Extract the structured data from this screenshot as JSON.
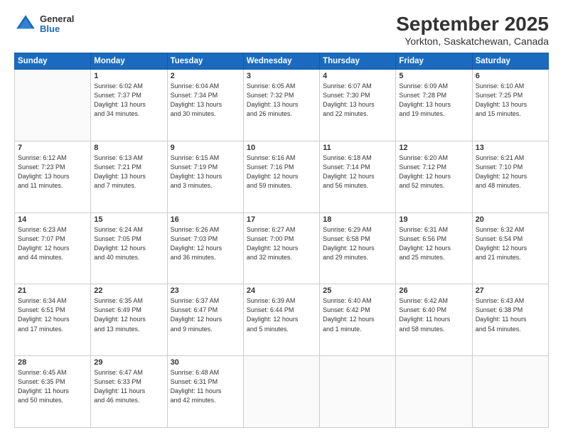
{
  "header": {
    "logo": {
      "general": "General",
      "blue": "Blue"
    },
    "title": "September 2025",
    "subtitle": "Yorkton, Saskatchewan, Canada"
  },
  "calendar": {
    "days_of_week": [
      "Sunday",
      "Monday",
      "Tuesday",
      "Wednesday",
      "Thursday",
      "Friday",
      "Saturday"
    ],
    "weeks": [
      [
        {
          "day": "",
          "info": ""
        },
        {
          "day": "1",
          "info": "Sunrise: 6:02 AM\nSunset: 7:37 PM\nDaylight: 13 hours\nand 34 minutes."
        },
        {
          "day": "2",
          "info": "Sunrise: 6:04 AM\nSunset: 7:34 PM\nDaylight: 13 hours\nand 30 minutes."
        },
        {
          "day": "3",
          "info": "Sunrise: 6:05 AM\nSunset: 7:32 PM\nDaylight: 13 hours\nand 26 minutes."
        },
        {
          "day": "4",
          "info": "Sunrise: 6:07 AM\nSunset: 7:30 PM\nDaylight: 13 hours\nand 22 minutes."
        },
        {
          "day": "5",
          "info": "Sunrise: 6:09 AM\nSunset: 7:28 PM\nDaylight: 13 hours\nand 19 minutes."
        },
        {
          "day": "6",
          "info": "Sunrise: 6:10 AM\nSunset: 7:25 PM\nDaylight: 13 hours\nand 15 minutes."
        }
      ],
      [
        {
          "day": "7",
          "info": "Sunrise: 6:12 AM\nSunset: 7:23 PM\nDaylight: 13 hours\nand 11 minutes."
        },
        {
          "day": "8",
          "info": "Sunrise: 6:13 AM\nSunset: 7:21 PM\nDaylight: 13 hours\nand 7 minutes."
        },
        {
          "day": "9",
          "info": "Sunrise: 6:15 AM\nSunset: 7:19 PM\nDaylight: 13 hours\nand 3 minutes."
        },
        {
          "day": "10",
          "info": "Sunrise: 6:16 AM\nSunset: 7:16 PM\nDaylight: 12 hours\nand 59 minutes."
        },
        {
          "day": "11",
          "info": "Sunrise: 6:18 AM\nSunset: 7:14 PM\nDaylight: 12 hours\nand 56 minutes."
        },
        {
          "day": "12",
          "info": "Sunrise: 6:20 AM\nSunset: 7:12 PM\nDaylight: 12 hours\nand 52 minutes."
        },
        {
          "day": "13",
          "info": "Sunrise: 6:21 AM\nSunset: 7:10 PM\nDaylight: 12 hours\nand 48 minutes."
        }
      ],
      [
        {
          "day": "14",
          "info": "Sunrise: 6:23 AM\nSunset: 7:07 PM\nDaylight: 12 hours\nand 44 minutes."
        },
        {
          "day": "15",
          "info": "Sunrise: 6:24 AM\nSunset: 7:05 PM\nDaylight: 12 hours\nand 40 minutes."
        },
        {
          "day": "16",
          "info": "Sunrise: 6:26 AM\nSunset: 7:03 PM\nDaylight: 12 hours\nand 36 minutes."
        },
        {
          "day": "17",
          "info": "Sunrise: 6:27 AM\nSunset: 7:00 PM\nDaylight: 12 hours\nand 32 minutes."
        },
        {
          "day": "18",
          "info": "Sunrise: 6:29 AM\nSunset: 6:58 PM\nDaylight: 12 hours\nand 29 minutes."
        },
        {
          "day": "19",
          "info": "Sunrise: 6:31 AM\nSunset: 6:56 PM\nDaylight: 12 hours\nand 25 minutes."
        },
        {
          "day": "20",
          "info": "Sunrise: 6:32 AM\nSunset: 6:54 PM\nDaylight: 12 hours\nand 21 minutes."
        }
      ],
      [
        {
          "day": "21",
          "info": "Sunrise: 6:34 AM\nSunset: 6:51 PM\nDaylight: 12 hours\nand 17 minutes."
        },
        {
          "day": "22",
          "info": "Sunrise: 6:35 AM\nSunset: 6:49 PM\nDaylight: 12 hours\nand 13 minutes."
        },
        {
          "day": "23",
          "info": "Sunrise: 6:37 AM\nSunset: 6:47 PM\nDaylight: 12 hours\nand 9 minutes."
        },
        {
          "day": "24",
          "info": "Sunrise: 6:39 AM\nSunset: 6:44 PM\nDaylight: 12 hours\nand 5 minutes."
        },
        {
          "day": "25",
          "info": "Sunrise: 6:40 AM\nSunset: 6:42 PM\nDaylight: 12 hours\nand 1 minute."
        },
        {
          "day": "26",
          "info": "Sunrise: 6:42 AM\nSunset: 6:40 PM\nDaylight: 11 hours\nand 58 minutes."
        },
        {
          "day": "27",
          "info": "Sunrise: 6:43 AM\nSunset: 6:38 PM\nDaylight: 11 hours\nand 54 minutes."
        }
      ],
      [
        {
          "day": "28",
          "info": "Sunrise: 6:45 AM\nSunset: 6:35 PM\nDaylight: 11 hours\nand 50 minutes."
        },
        {
          "day": "29",
          "info": "Sunrise: 6:47 AM\nSunset: 6:33 PM\nDaylight: 11 hours\nand 46 minutes."
        },
        {
          "day": "30",
          "info": "Sunrise: 6:48 AM\nSunset: 6:31 PM\nDaylight: 11 hours\nand 42 minutes."
        },
        {
          "day": "",
          "info": ""
        },
        {
          "day": "",
          "info": ""
        },
        {
          "day": "",
          "info": ""
        },
        {
          "day": "",
          "info": ""
        }
      ]
    ]
  }
}
